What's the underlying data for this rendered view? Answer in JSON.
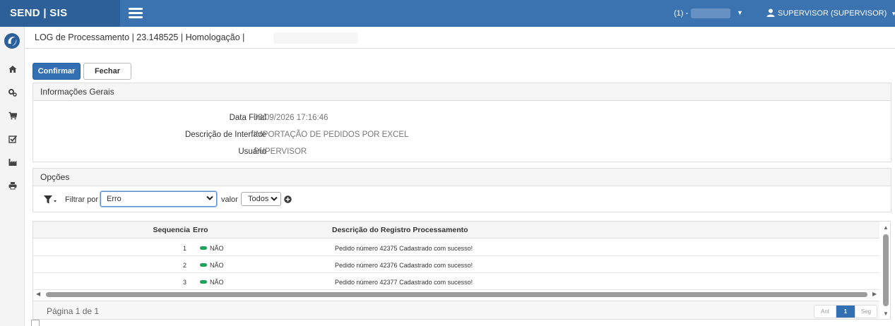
{
  "app": {
    "brand": "SEND | SIS"
  },
  "topbar": {
    "environment": "(1) -",
    "user": "SUPERVISOR (SUPERVISOR)"
  },
  "page": {
    "title": "LOG de Processamento | 23.148525 | Homologação |"
  },
  "actions": {
    "confirm": "Confirmar",
    "close": "Fechar"
  },
  "info": {
    "heading": "Informações Gerais",
    "fields": [
      {
        "label": "Data Final",
        "value": "03/09/2026 17:16:46"
      },
      {
        "label": "Descrição de Interface",
        "value": "IMPORTAÇÃO DE PEDIDOS POR EXCEL"
      },
      {
        "label": "Usuário",
        "value": "SUPERVISOR"
      }
    ]
  },
  "options": {
    "heading": "Opções",
    "filter_label": "Filtrar por",
    "filter_value": "Erro",
    "valor_label": "valor",
    "valor_value": "Todos"
  },
  "grid": {
    "columns": [
      "Sequencia",
      "Erro",
      "Descrição do Registro Processamento"
    ],
    "rows": [
      {
        "seq": "1",
        "erro": "NÃO",
        "desc": "Pedido número 42375 Cadastrado com sucesso!"
      },
      {
        "seq": "2",
        "erro": "NÃO",
        "desc": "Pedido número 42376 Cadastrado com sucesso!"
      },
      {
        "seq": "3",
        "erro": "NÃO",
        "desc": "Pedido número 42377 Cadastrado com sucesso!"
      }
    ],
    "page_info": "Página 1 de 1",
    "pager": {
      "prev": "Ant",
      "current": "1",
      "next": "Seg"
    }
  },
  "colors": {
    "topbar": "#3b73b1",
    "brand_bg": "#2d5f99",
    "primary": "#336fb3",
    "status_ok": "#1ea35c"
  },
  "icons": {
    "sidebar": [
      "home-icon",
      "cogs-icon",
      "cart-icon",
      "check-square-icon",
      "factory-icon",
      "print-icon"
    ]
  }
}
